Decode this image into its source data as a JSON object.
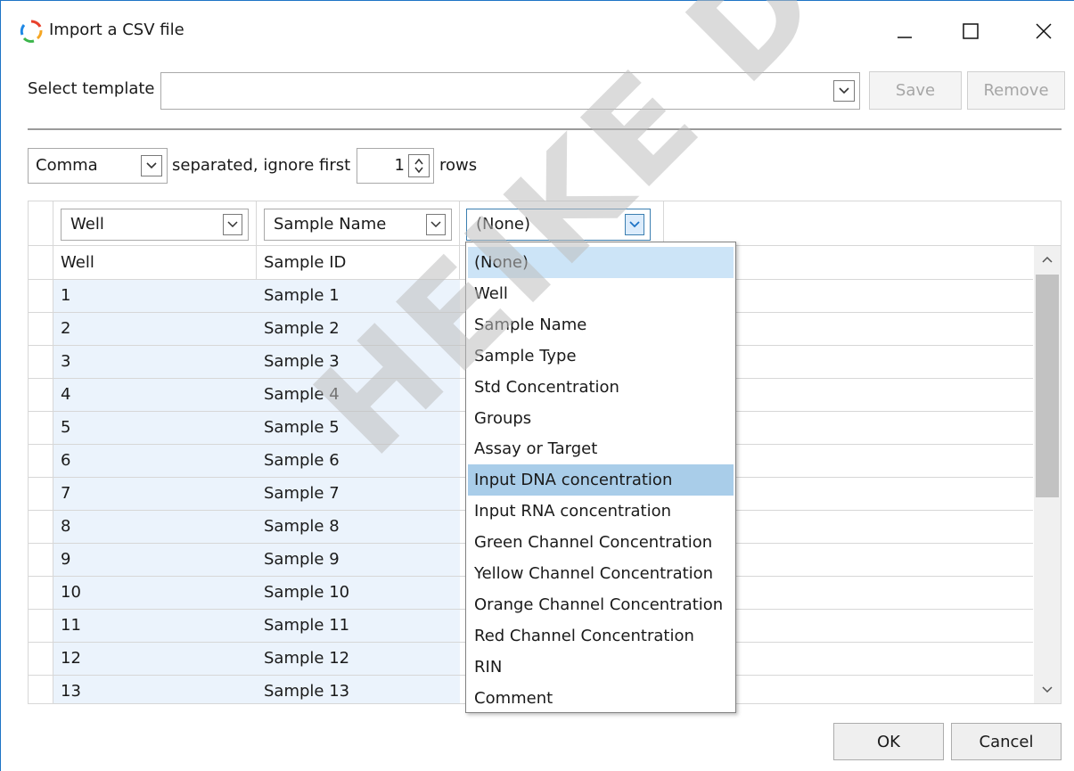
{
  "window": {
    "title": "Import a CSV file"
  },
  "template": {
    "label": "Select template",
    "value": "",
    "save_label": "Save",
    "remove_label": "Remove"
  },
  "separator": {
    "value": "Comma",
    "text": "separated, ignore first",
    "ignore_rows": "1",
    "rows_text": "rows"
  },
  "columns": [
    {
      "mapping": "Well"
    },
    {
      "mapping": "Sample Name"
    },
    {
      "mapping": "(None)"
    }
  ],
  "table": {
    "header": [
      "Well",
      "Sample ID"
    ],
    "rows": [
      [
        "1",
        "Sample 1"
      ],
      [
        "2",
        "Sample 2"
      ],
      [
        "3",
        "Sample 3"
      ],
      [
        "4",
        "Sample 4"
      ],
      [
        "5",
        "Sample 5"
      ],
      [
        "6",
        "Sample 6"
      ],
      [
        "7",
        "Sample 7"
      ],
      [
        "8",
        "Sample 8"
      ],
      [
        "9",
        "Sample 9"
      ],
      [
        "10",
        "Sample 10"
      ],
      [
        "11",
        "Sample 11"
      ],
      [
        "12",
        "Sample 12"
      ],
      [
        "13",
        "Sample 13"
      ]
    ]
  },
  "dropdown": {
    "options": [
      "(None)",
      "Well",
      "Sample Name",
      "Sample Type",
      "Std Concentration",
      "Groups",
      "Assay or Target",
      "Input DNA concentration",
      "Input RNA concentration",
      "Green Channel Concentration",
      "Yellow Channel Concentration",
      "Orange Channel Concentration",
      "Red Channel Concentration",
      "RIN",
      "Comment"
    ],
    "selected_index": 0,
    "hover_index": 7
  },
  "footer": {
    "ok_label": "OK",
    "cancel_label": "Cancel"
  },
  "watermark": "HEIKE DUTSCHER SAS",
  "colors": {
    "accent": "#1e74c6",
    "selected_cell": "#ebf3fc",
    "dropdown_highlight": "#cce4f7",
    "dropdown_hover": "#a9cde9"
  }
}
